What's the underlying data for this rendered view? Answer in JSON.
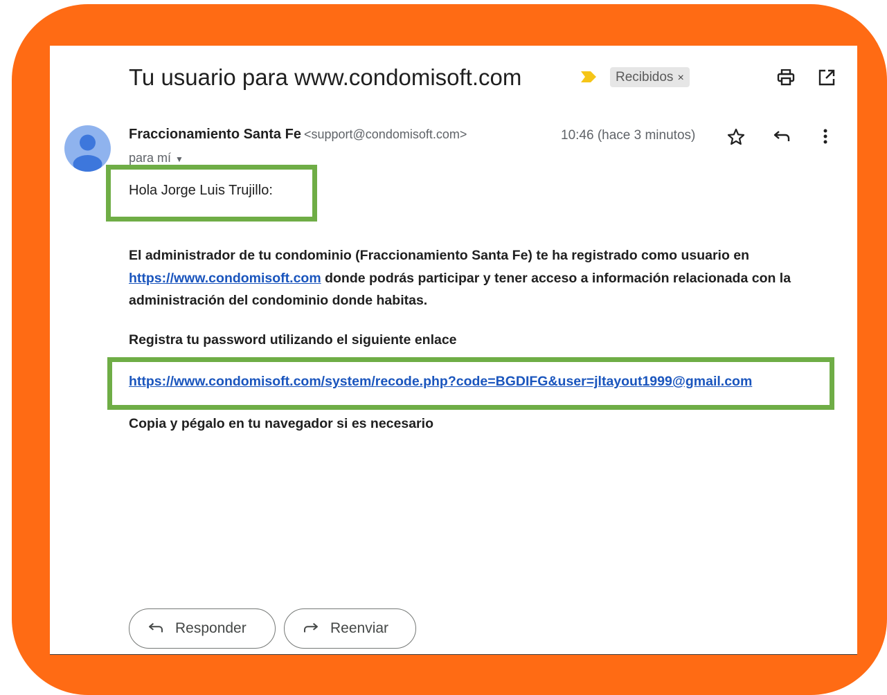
{
  "email": {
    "subject": "Tu usuario para www.condomisoft.com",
    "label_chip": "Recibidos",
    "label_chip_close": "×",
    "sender_name": "Fraccionamiento Santa Fe",
    "sender_email": "<support@condomisoft.com>",
    "timestamp": "10:46 (hace 3 minutos)",
    "recipient": "para mí",
    "greeting": "Hola Jorge Luis Trujillo:",
    "body_intro": "El administrador de tu condominio (Fraccionamiento Santa Fe) te ha registrado como usuario en",
    "body_link": "https://www.condomisoft.com",
    "body_outro": "donde podrás participar y tener acceso a información relacionada con la administración del condominio donde habitas.",
    "register_text": "Registra tu password utilizando el siguiente enlace",
    "register_link": "https://www.condomisoft.com/system/recode.php?code=BGDIFG&user=jltayout1999@gmail.com",
    "copy_text": "Copia y pégalo en tu navegador si es necesario"
  },
  "actions": {
    "reply_label": "Responder",
    "forward_label": "Reenviar"
  },
  "icons": {
    "importance": "importance-marker-icon",
    "print": "print-icon",
    "open_new_window": "open-in-new-window-icon",
    "star": "star-icon",
    "reply": "reply-icon",
    "more": "more-vert-icon",
    "avatar": "avatar-person-icon",
    "dropdown": "dropdown-caret-icon",
    "forward": "forward-icon"
  },
  "colors": {
    "frame": "#FF6B14",
    "highlight_box": "#6FAD46",
    "link": "#1a55bd",
    "importance_marker": "#F5C518",
    "avatar_bg": "#8fb3ee",
    "avatar_fg": "#3d77dc"
  }
}
